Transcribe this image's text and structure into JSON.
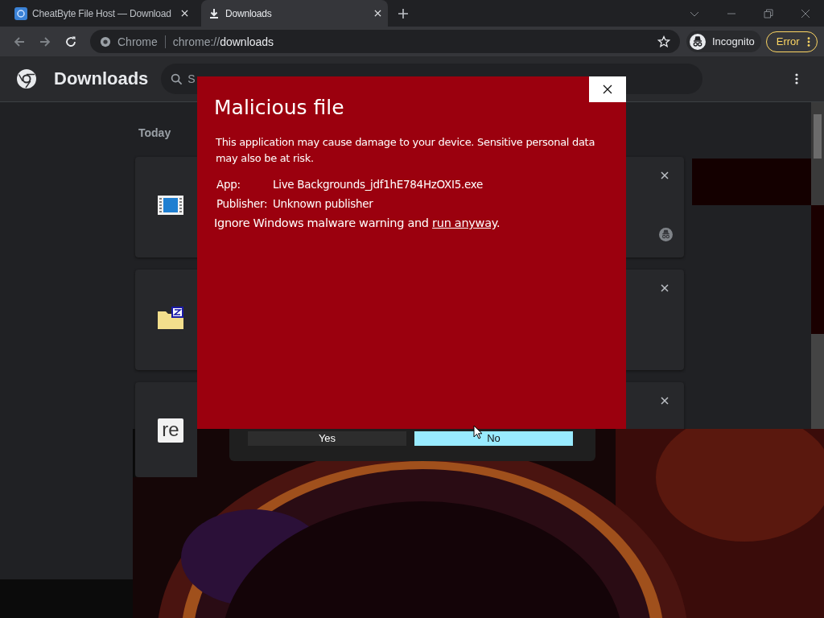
{
  "tabs": [
    {
      "title": "CheatByte File Host — Download",
      "kind": "site",
      "selected": false
    },
    {
      "title": "Downloads",
      "kind": "download",
      "selected": true
    }
  ],
  "omnibox": {
    "chip": "Chrome",
    "url_prefix": "chrome://",
    "url_host": "downloads"
  },
  "profile": {
    "label": "Incognito"
  },
  "error_button": {
    "label": "Error"
  },
  "page": {
    "title": "Downloads",
    "search": {
      "placeholder": "S"
    }
  },
  "section": "Today",
  "downloads": [
    {
      "kind": "film",
      "incognito": true
    },
    {
      "kind": "zip"
    },
    {
      "kind": "text",
      "icon_text": "re"
    }
  ],
  "dialog": {
    "title": "Malicious file",
    "message": "This application may cause damage to your device. Sensitive personal data may also be at risk.",
    "app_label": "App:",
    "app": "Live Backgrounds_jdf1hE784HzOXI5.exe",
    "publisher_label": "Publisher:",
    "publisher": "Unknown publisher",
    "ignore_text": "Ignore Windows malware warning and ",
    "ignore_link": "run anyway",
    "ignore_end": "."
  },
  "prompt": {
    "buttons": [
      {
        "label": "Yes",
        "selected": false
      },
      {
        "label": "No",
        "selected": true
      }
    ]
  }
}
